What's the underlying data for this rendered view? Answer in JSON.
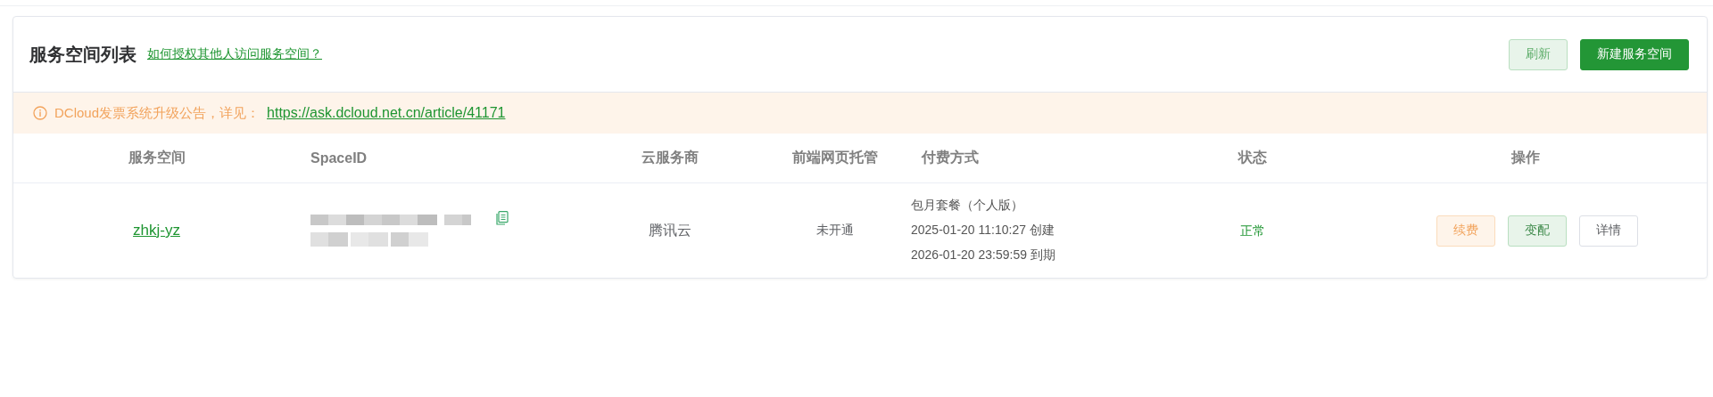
{
  "header": {
    "title": "服务空间列表",
    "help_link": "如何授权其他人访问服务空间？",
    "buttons": [
      {
        "label": "刷新",
        "kind": "light"
      },
      {
        "label": "新建服务空间",
        "kind": "primary"
      }
    ]
  },
  "notice": {
    "text": "DCloud发票系统升级公告，详见：",
    "link": "https://ask.dcloud.net.cn/article/41171"
  },
  "table": {
    "columns": [
      "服务空间",
      "SpaceID",
      "云服务商",
      "前端网页托管",
      "付费方式",
      "状态",
      "操作"
    ],
    "rows": [
      {
        "name": "zhkj-yz",
        "provider": "腾讯云",
        "hosting": "未开通",
        "payment": [
          "包月套餐（个人版）",
          "2025-01-20 11:10:27 创建",
          "2026-01-20 23:59:59 到期"
        ],
        "status": "正常",
        "actions": [
          {
            "label": "续费",
            "kind": "warning"
          },
          {
            "label": "变配",
            "kind": "success"
          },
          {
            "label": "详情",
            "kind": "plain"
          }
        ]
      }
    ]
  }
}
